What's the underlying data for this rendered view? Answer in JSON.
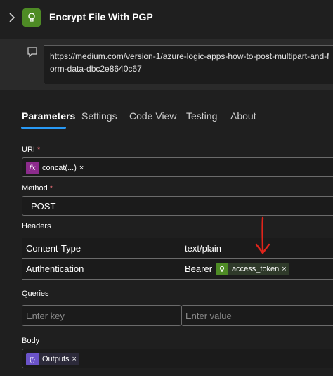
{
  "header": {
    "title": "Encrypt File With PGP"
  },
  "comment": {
    "text": "https://medium.com/version-1/azure-logic-apps-how-to-post-multipart-and-form-data-dbc2e8640c67"
  },
  "tabs": [
    {
      "label": "Parameters",
      "active": true
    },
    {
      "label": "Settings",
      "active": false
    },
    {
      "label": "Code View",
      "active": false
    },
    {
      "label": "Testing",
      "active": false
    },
    {
      "label": "About",
      "active": false
    }
  ],
  "uri": {
    "label": "URI",
    "required_mark": "*",
    "token": {
      "icon_text": "fx",
      "label": "concat(...)",
      "remove": "×",
      "color": "#8c2b8c"
    }
  },
  "method": {
    "label": "Method",
    "required_mark": "*",
    "value": "POST"
  },
  "headers": {
    "label": "Headers",
    "rows": [
      {
        "key": "Content-Type",
        "value": "text/plain"
      },
      {
        "key": "Authentication",
        "value_prefix": "Bearer",
        "token": {
          "label": "access_token",
          "remove": "×",
          "color": "#4e8b25"
        }
      }
    ]
  },
  "queries": {
    "label": "Queries",
    "key_placeholder": "Enter key",
    "value_placeholder": "Enter value"
  },
  "body": {
    "label": "Body",
    "token": {
      "icon_text": "{/}",
      "label": "Outputs",
      "remove": "×",
      "color": "#6b53c9"
    }
  },
  "annotation": {
    "arrow_color": "#e0241b"
  },
  "colors": {
    "accent": "#2899f5",
    "required": "#f1707b"
  }
}
